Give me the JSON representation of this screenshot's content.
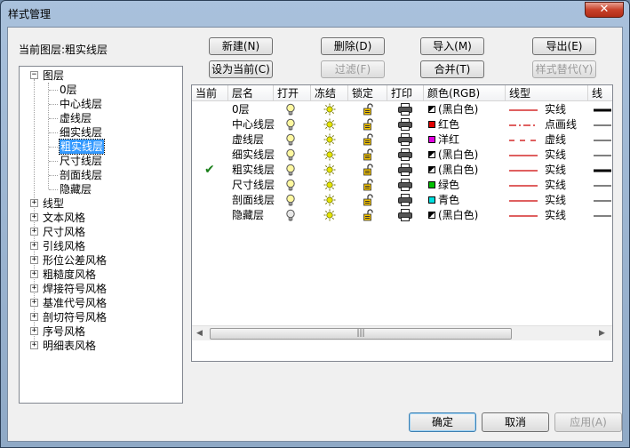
{
  "window": {
    "title": "样式管理",
    "close_glyph": "✕"
  },
  "current_layer_label": "当前图层:粗实线层",
  "toolbar": {
    "new": "新建(N)",
    "delete": "删除(D)",
    "import": "导入(M)",
    "export": "导出(E)",
    "set_current": "设为当前(C)",
    "filter": "过滤(F)",
    "merge": "合并(T)",
    "style_replace": "样式替代(Y)"
  },
  "tree": {
    "root": {
      "label": "图层",
      "expanded": true
    },
    "layers": [
      "0层",
      "中心线层",
      "虚线层",
      "细实线层",
      "粗实线层",
      "尺寸线层",
      "剖面线层",
      "隐藏层"
    ],
    "selected_layer": "粗实线层",
    "categories": [
      "线型",
      "文本风格",
      "尺寸风格",
      "引线风格",
      "形位公差风格",
      "粗糙度风格",
      "焊接符号风格",
      "基准代号风格",
      "剖切符号风格",
      "序号风格",
      "明细表风格"
    ]
  },
  "grid": {
    "columns": [
      "当前",
      "层名",
      "打开",
      "冻结",
      "锁定",
      "打印",
      "颜色(RGB)",
      "线型",
      "线"
    ],
    "rows": [
      {
        "current": "",
        "name": "0层",
        "color_name": "(黑白色)",
        "color_hex": "#000000",
        "linetype_name": "实线",
        "linetype_style": "solid",
        "lineweight": "thick"
      },
      {
        "current": "",
        "name": "中心线层",
        "color_name": "红色",
        "color_hex": "#e00000",
        "linetype_name": "点画线",
        "linetype_style": "dashdot",
        "lineweight": "thin"
      },
      {
        "current": "",
        "name": "虚线层",
        "color_name": "洋红",
        "color_hex": "#e000e0",
        "linetype_name": "虚线",
        "linetype_style": "dashed",
        "lineweight": "thin"
      },
      {
        "current": "",
        "name": "细实线层",
        "color_name": "(黑白色)",
        "color_hex": "#000000",
        "linetype_name": "实线",
        "linetype_style": "solid",
        "lineweight": "thin"
      },
      {
        "current": "✔",
        "name": "粗实线层",
        "color_name": "(黑白色)",
        "color_hex": "#000000",
        "linetype_name": "实线",
        "linetype_style": "solid",
        "lineweight": "thick"
      },
      {
        "current": "",
        "name": "尺寸线层",
        "color_name": "绿色",
        "color_hex": "#00c000",
        "linetype_name": "实线",
        "linetype_style": "solid",
        "lineweight": "thin"
      },
      {
        "current": "",
        "name": "剖面线层",
        "color_name": "青色",
        "color_hex": "#00e0e0",
        "linetype_name": "实线",
        "linetype_style": "solid",
        "lineweight": "thin"
      },
      {
        "current": "",
        "name": "隐藏层",
        "color_name": "(黑白色)",
        "color_hex": "#000000",
        "linetype_name": "实线",
        "linetype_style": "solid",
        "lineweight": "thin"
      }
    ],
    "scrollbar_grip": "|||"
  },
  "footer": {
    "ok": "确定",
    "cancel": "取消",
    "apply": "应用(A)"
  },
  "colors": {
    "selection": "#3399ff",
    "linetype_red": "#cc0000",
    "check_green": "#1a7f1a"
  }
}
